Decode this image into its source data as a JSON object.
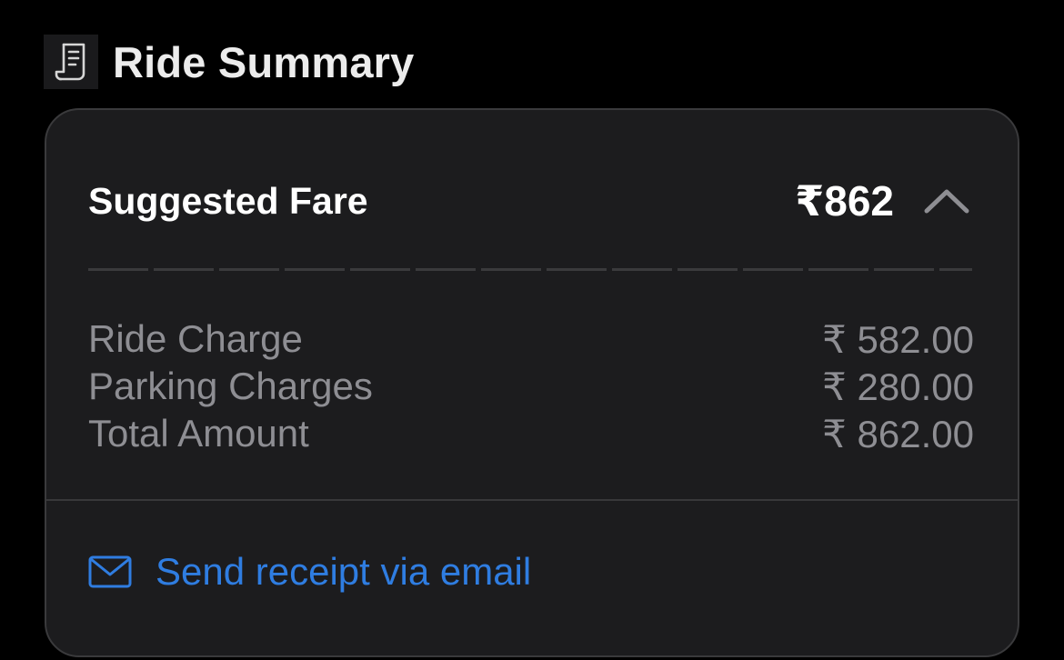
{
  "header": {
    "icon": "receipt-icon",
    "title": "Ride Summary"
  },
  "fare": {
    "label": "Suggested Fare",
    "value": "₹862",
    "toggle_icon": "chevron-up-icon"
  },
  "breakdown": {
    "items": [
      {
        "label": "Ride Charge",
        "amount": "₹ 582.00"
      },
      {
        "label": "Parking Charges",
        "amount": "₹ 280.00"
      },
      {
        "label": "Total Amount",
        "amount": "₹ 862.00"
      }
    ]
  },
  "email": {
    "icon": "mail-icon",
    "label": "Send receipt via email"
  },
  "colors": {
    "background": "#000000",
    "card": "#1c1c1e",
    "accent": "#2f7de1",
    "muted_text": "#8e8e93"
  }
}
